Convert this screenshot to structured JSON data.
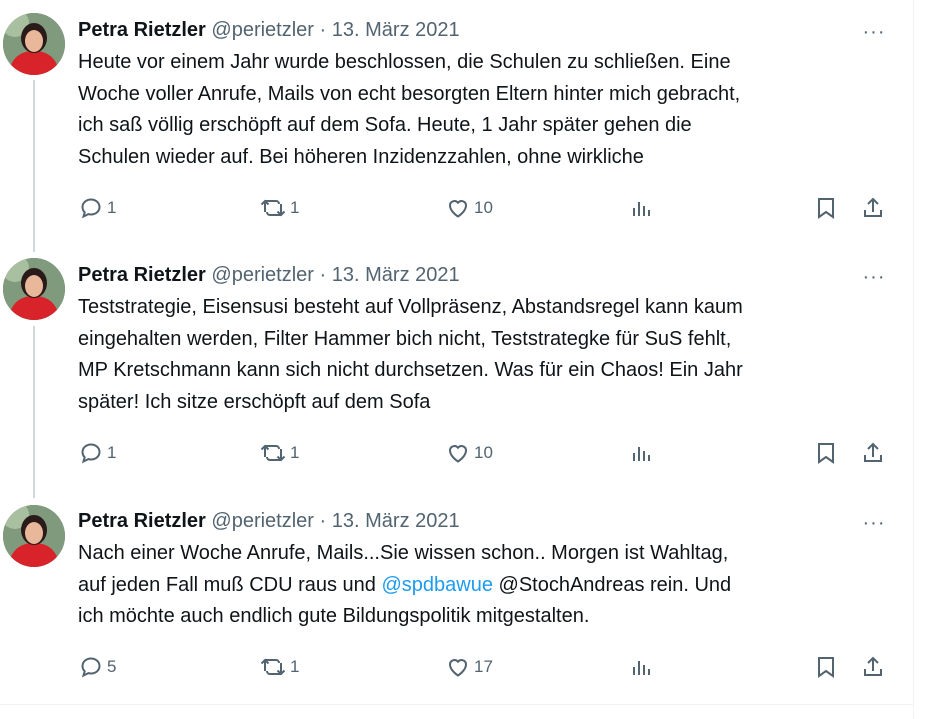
{
  "tweets": [
    {
      "author_name": "Petra Rietzler",
      "handle": "@perietzler",
      "separator": "·",
      "date": "13. März 2021",
      "more_icon": "···",
      "lines": [
        "Heute vor einem Jahr wurde beschlossen,  die Schulen zu schließen. Eine",
        "Woche voller Anrufe, Mails von echt besorgten Eltern hinter mich gebracht,",
        "ich saß völlig erschöpft auf dem Sofa. Heute, 1 Jahr später gehen die",
        "Schulen wieder auf. Bei höheren  Inzidenzzahlen, ohne wirkliche"
      ],
      "replies": "1",
      "retweets": "1",
      "likes": "10"
    },
    {
      "author_name": "Petra Rietzler",
      "handle": "@perietzler",
      "separator": "·",
      "date": "13. März 2021",
      "more_icon": "···",
      "lines": [
        "Teststrategie, Eisensusi besteht auf Vollpräsenz, Abstandsregel kann kaum",
        "eingehalten werden, Filter Hammer bich nicht, Teststrategke für SuS fehlt,",
        "MP Kretschmann kann sich nicht durchsetzen. Was für ein Chaos! Ein Jahr",
        "später! Ich sitze erschöpft auf dem Sofa"
      ],
      "replies": "1",
      "retweets": "1",
      "likes": "10"
    },
    {
      "author_name": "Petra Rietzler",
      "handle": "@perietzler",
      "separator": "·",
      "date": "13. März 2021",
      "more_icon": "···",
      "line1": "Nach einer Woche Anrufe, Mails...Sie wissen schon.. Morgen ist Wahltag,",
      "line2_pre": "auf jeden Fall muß CDU raus und ",
      "line2_mention": "@spdbawue",
      "line2_post": " @StochAndreas rein.  Und",
      "line3": "ich möchte auch endlich gute Bildungspolitik mitgestalten.",
      "replies": "5",
      "retweets": "1",
      "likes": "17"
    }
  ],
  "icons": {
    "reply": "reply-icon",
    "retweet": "retweet-icon",
    "like": "heart-icon",
    "views": "views-chart-icon",
    "bookmark": "bookmark-icon",
    "share": "share-icon"
  },
  "colors": {
    "text": "#0f1419",
    "secondary": "#536471",
    "link": "#1d9bf0",
    "thread_line": "#cfd9de"
  }
}
